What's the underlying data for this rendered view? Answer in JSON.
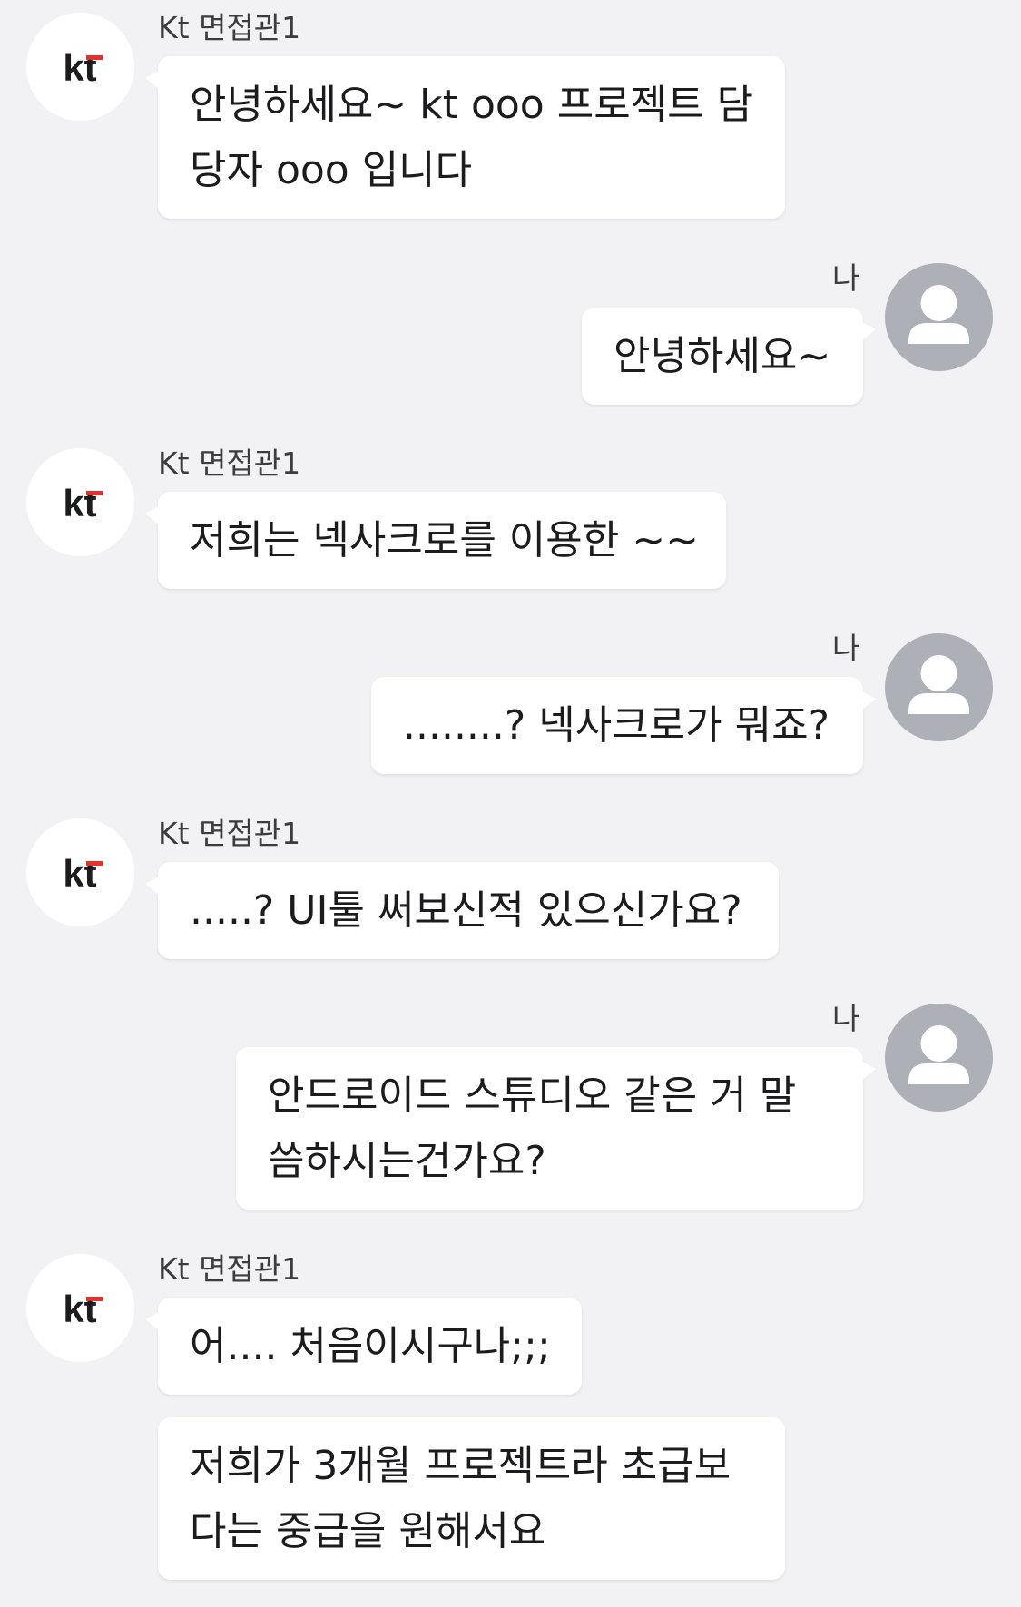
{
  "chat": {
    "interviewer_name": "Kt 면접관1",
    "me_name": "나",
    "kt_logo": {
      "text": "kt",
      "accent_color": "#e3322e"
    },
    "messages": [
      {
        "sender": "interviewer",
        "lines": [
          "안녕하세요~ kt ooo 프로젝트 담",
          "당자 ooo 입니다"
        ]
      },
      {
        "sender": "me",
        "lines": [
          "안녕하세요~"
        ]
      },
      {
        "sender": "interviewer",
        "lines": [
          "저희는 넥사크로를 이용한 ~~"
        ]
      },
      {
        "sender": "me",
        "lines": [
          "........? 넥사크로가 뭐죠?"
        ]
      },
      {
        "sender": "interviewer",
        "lines": [
          ".....? UI툴 써보신적 있으신가요?"
        ]
      },
      {
        "sender": "me",
        "lines": [
          "안드로이드 스튜디오 같은 거 말",
          "씀하시는건가요?"
        ]
      },
      {
        "sender": "interviewer",
        "lines": [
          "어.... 처음이시구나;;;"
        ]
      },
      {
        "sender": "interviewer",
        "lines": [
          "저희가 3개월 프로젝트라 초급보",
          "다는 중급을 원해서요"
        ]
      }
    ]
  }
}
